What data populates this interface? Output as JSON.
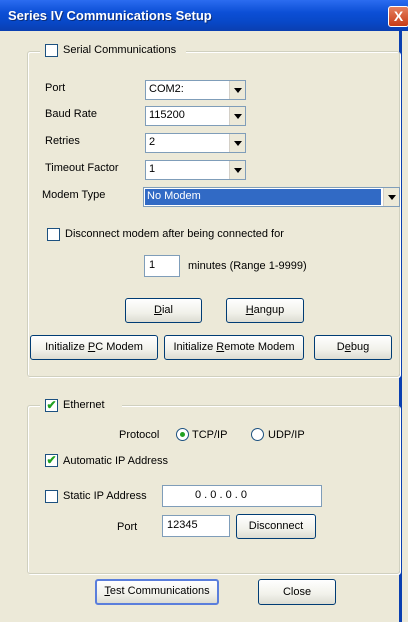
{
  "window": {
    "title": "Series IV Communications Setup",
    "close_glyph": "X"
  },
  "serial": {
    "label": "Serial Communications",
    "checked": false,
    "port": {
      "label": "Port",
      "value": "COM2:"
    },
    "baud": {
      "label": "Baud Rate",
      "value": "115200"
    },
    "retries": {
      "label": "Retries",
      "value": "2"
    },
    "timeout": {
      "label": "Timeout Factor",
      "value": "1"
    },
    "modem": {
      "label": "Modem Type",
      "value": "No Modem"
    },
    "disconnect": {
      "label": "Disconnect modem after being connected for",
      "checked": false
    },
    "minutes": {
      "value": "1",
      "label": "minutes (Range 1-9999)"
    },
    "dial": {
      "pre": "",
      "key": "D",
      "post": "ial"
    },
    "hangup": {
      "pre": "",
      "key": "H",
      "post": "angup"
    },
    "init_pc": {
      "pre": "Initialize ",
      "key": "P",
      "post": "C Modem"
    },
    "init_remote": {
      "pre": "Initialize ",
      "key": "R",
      "post": "emote Modem"
    },
    "debug": {
      "pre": "D",
      "key": "e",
      "post": "bug"
    }
  },
  "ethernet": {
    "label": "Ethernet",
    "checked": true,
    "protocol_label": "Protocol",
    "tcp_label": "TCP/IP",
    "tcp_selected": true,
    "udp_label": "UDP/IP",
    "udp_selected": false,
    "auto_ip": {
      "label": "Automatic IP Address",
      "checked": true
    },
    "static_ip": {
      "label": "Static IP Address",
      "checked": false,
      "value": "0 . 0 . 0 . 0"
    },
    "port": {
      "label": "Port",
      "value": "12345"
    },
    "disconnect_label": "Disconnect"
  },
  "footer": {
    "test": {
      "pre": "",
      "key": "T",
      "post": "est Communications"
    },
    "close_label": "Close"
  },
  "check_glyph": "✔"
}
